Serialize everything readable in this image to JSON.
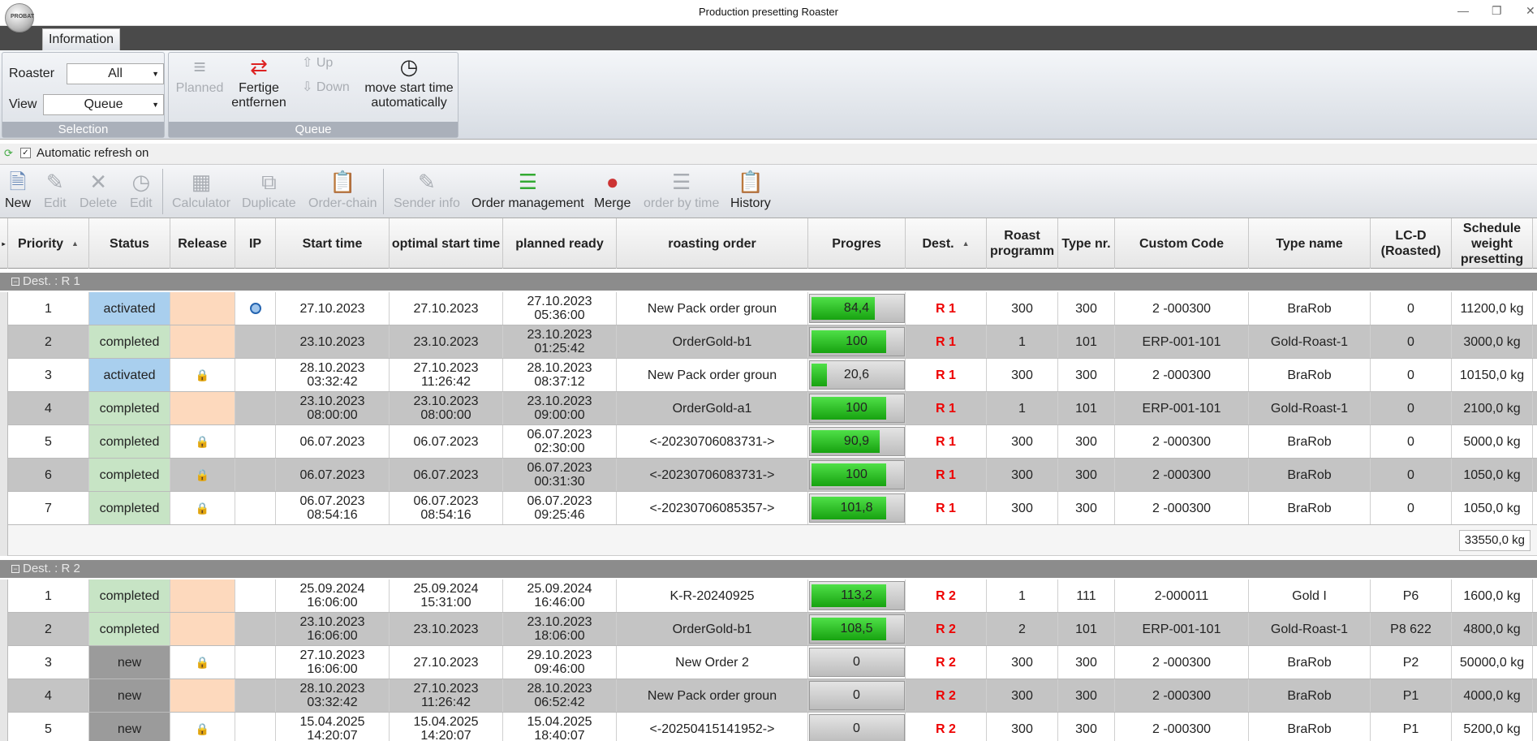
{
  "window": {
    "title": "Production presetting Roaster",
    "logo_text": "PROBAT"
  },
  "tabs": [
    {
      "label": "Information"
    }
  ],
  "selection": {
    "roaster_label": "Roaster",
    "roaster_value": "All",
    "view_label": "View",
    "view_value": "Queue",
    "caption": "Selection"
  },
  "queue": {
    "planned": "Planned",
    "fertige_1": "Fertige",
    "fertige_2": "entfernen",
    "up": "Up",
    "down": "Down",
    "move_1": "move start time",
    "move_2": "automatically",
    "caption": "Queue"
  },
  "refresh": {
    "label": "Automatic refresh on",
    "checked": true
  },
  "toolbar": {
    "new": "New",
    "edit": "Edit",
    "delete": "Delete",
    "edit2": "Edit",
    "calculator": "Calculator",
    "duplicate": "Duplicate",
    "order_chain": "Order-chain",
    "sender_info": "Sender info",
    "order_management": "Order management",
    "merge": "Merge",
    "order_by_time": "order by time",
    "history": "History"
  },
  "columns": {
    "priority": "Priority",
    "status": "Status",
    "release": "Release",
    "ip": "IP",
    "start_time": "Start time",
    "optimal_start": "optimal start time",
    "planned_ready": "planned ready",
    "roasting_order": "roasting order",
    "progres": "Progres",
    "dest": "Dest.",
    "roast_1": "Roast",
    "roast_2": "programm",
    "type_nr": "Type nr.",
    "custom_code": "Custom Code",
    "type_name": "Type name",
    "lcd_1": "LC-D",
    "lcd_2": "(Roasted)",
    "sched_1": "Schedule",
    "sched_2": "weight",
    "sched_3": "presetting"
  },
  "groups": [
    {
      "label": "Dest. : R 1",
      "total": "33550,0 kg",
      "rows": [
        {
          "priority": "1",
          "status": "activated",
          "release": "peach",
          "ip": true,
          "start1": "27.10.2023",
          "start2": "",
          "opt1": "27.10.2023",
          "opt2": "",
          "ready1": "27.10.2023",
          "ready2": "05:36:00",
          "order": "New Pack order groun",
          "progress": 84.4,
          "progress_label": "84,4",
          "dest": "R 1",
          "roast": "300",
          "type_nr": "300",
          "custom": "2 -000300",
          "type_name": "BraRob",
          "lcd": "0",
          "weight": "11200,0 kg"
        },
        {
          "priority": "2",
          "status": "completed",
          "release": "peach",
          "ip": false,
          "start1": "23.10.2023",
          "start2": "",
          "opt1": "23.10.2023",
          "opt2": "",
          "ready1": "23.10.2023",
          "ready2": "01:25:42",
          "order": "OrderGold-b1",
          "progress": 100,
          "progress_label": "100",
          "dest": "R 1",
          "roast": "1",
          "type_nr": "101",
          "custom": "ERP-001-101",
          "type_name": "Gold-Roast-1",
          "lcd": "0",
          "weight": "3000,0 kg"
        },
        {
          "priority": "3",
          "status": "activated",
          "release": "lock",
          "ip": false,
          "start1": "28.10.2023",
          "start2": "03:32:42",
          "opt1": "27.10.2023",
          "opt2": "11:26:42",
          "ready1": "28.10.2023",
          "ready2": "08:37:12",
          "order": "New Pack order groun",
          "progress": 20.6,
          "progress_label": "20,6",
          "dest": "R 1",
          "roast": "300",
          "type_nr": "300",
          "custom": "2 -000300",
          "type_name": "BraRob",
          "lcd": "0",
          "weight": "10150,0 kg"
        },
        {
          "priority": "4",
          "status": "completed",
          "release": "peach",
          "ip": false,
          "start1": "23.10.2023",
          "start2": "08:00:00",
          "opt1": "23.10.2023",
          "opt2": "08:00:00",
          "ready1": "23.10.2023",
          "ready2": "09:00:00",
          "order": "OrderGold-a1",
          "progress": 100,
          "progress_label": "100",
          "dest": "R 1",
          "roast": "1",
          "type_nr": "101",
          "custom": "ERP-001-101",
          "type_name": "Gold-Roast-1",
          "lcd": "0",
          "weight": "2100,0 kg"
        },
        {
          "priority": "5",
          "status": "completed",
          "release": "lock",
          "ip": false,
          "start1": "06.07.2023",
          "start2": "",
          "opt1": "06.07.2023",
          "opt2": "",
          "ready1": "06.07.2023",
          "ready2": "02:30:00",
          "order": "<-20230706083731->",
          "progress": 90.9,
          "progress_label": "90,9",
          "dest": "R 1",
          "roast": "300",
          "type_nr": "300",
          "custom": "2 -000300",
          "type_name": "BraRob",
          "lcd": "0",
          "weight": "5000,0 kg"
        },
        {
          "priority": "6",
          "status": "completed",
          "release": "lock",
          "ip": false,
          "start1": "06.07.2023",
          "start2": "",
          "opt1": "06.07.2023",
          "opt2": "",
          "ready1": "06.07.2023",
          "ready2": "00:31:30",
          "order": "<-20230706083731->",
          "progress": 100,
          "progress_label": "100",
          "dest": "R 1",
          "roast": "300",
          "type_nr": "300",
          "custom": "2 -000300",
          "type_name": "BraRob",
          "lcd": "0",
          "weight": "1050,0 kg"
        },
        {
          "priority": "7",
          "status": "completed",
          "release": "lock",
          "ip": false,
          "start1": "06.07.2023",
          "start2": "08:54:16",
          "opt1": "06.07.2023",
          "opt2": "08:54:16",
          "ready1": "06.07.2023",
          "ready2": "09:25:46",
          "order": "<-20230706085357->",
          "progress": 101.8,
          "progress_label": "101,8",
          "dest": "R 1",
          "roast": "300",
          "type_nr": "300",
          "custom": "2 -000300",
          "type_name": "BraRob",
          "lcd": "0",
          "weight": "1050,0 kg"
        }
      ]
    },
    {
      "label": "Dest. : R 2",
      "total": "",
      "rows": [
        {
          "priority": "1",
          "status": "completed",
          "release": "peach",
          "ip": false,
          "start1": "25.09.2024",
          "start2": "16:06:00",
          "opt1": "25.09.2024",
          "opt2": "15:31:00",
          "ready1": "25.09.2024",
          "ready2": "16:46:00",
          "order": "K-R-20240925",
          "progress": 113.2,
          "progress_label": "113,2",
          "dest": "R 2",
          "roast": "1",
          "type_nr": "111",
          "custom": "2-000011",
          "type_name": "Gold I",
          "lcd": "P6",
          "weight": "1600,0 kg"
        },
        {
          "priority": "2",
          "status": "completed",
          "release": "peach",
          "ip": false,
          "start1": "23.10.2023",
          "start2": "16:06:00",
          "opt1": "23.10.2023",
          "opt2": "",
          "ready1": "23.10.2023",
          "ready2": "18:06:00",
          "order": "OrderGold-b1",
          "progress": 108.5,
          "progress_label": "108,5",
          "dest": "R 2",
          "roast": "2",
          "type_nr": "101",
          "custom": "ERP-001-101",
          "type_name": "Gold-Roast-1",
          "lcd": "P8 622",
          "weight": "4800,0 kg"
        },
        {
          "priority": "3",
          "status": "new",
          "release": "lock",
          "ip": false,
          "start1": "27.10.2023",
          "start2": "16:06:00",
          "opt1": "27.10.2023",
          "opt2": "",
          "ready1": "29.10.2023",
          "ready2": "09:46:00",
          "order": "New Order 2",
          "progress": 0,
          "progress_label": "0",
          "dest": "R 2",
          "roast": "300",
          "type_nr": "300",
          "custom": "2 -000300",
          "type_name": "BraRob",
          "lcd": "P2",
          "weight": "50000,0 kg"
        },
        {
          "priority": "4",
          "status": "new",
          "release": "peach",
          "ip": false,
          "start1": "28.10.2023",
          "start2": "03:32:42",
          "opt1": "27.10.2023",
          "opt2": "11:26:42",
          "ready1": "28.10.2023",
          "ready2": "06:52:42",
          "order": "New Pack order groun",
          "progress": 0,
          "progress_label": "0",
          "dest": "R 2",
          "roast": "300",
          "type_nr": "300",
          "custom": "2 -000300",
          "type_name": "BraRob",
          "lcd": "P1",
          "weight": "4000,0 kg"
        },
        {
          "priority": "5",
          "status": "new",
          "release": "lock",
          "ip": false,
          "start1": "15.04.2025",
          "start2": "14:20:07",
          "opt1": "15.04.2025",
          "opt2": "14:20:07",
          "ready1": "15.04.2025",
          "ready2": "18:40:07",
          "order": "<-20250415141952->",
          "progress": 0,
          "progress_label": "0",
          "dest": "R 2",
          "roast": "300",
          "type_nr": "300",
          "custom": "2 -000300",
          "type_name": "BraRob",
          "lcd": "P1",
          "weight": "5200,0 kg"
        }
      ]
    }
  ]
}
